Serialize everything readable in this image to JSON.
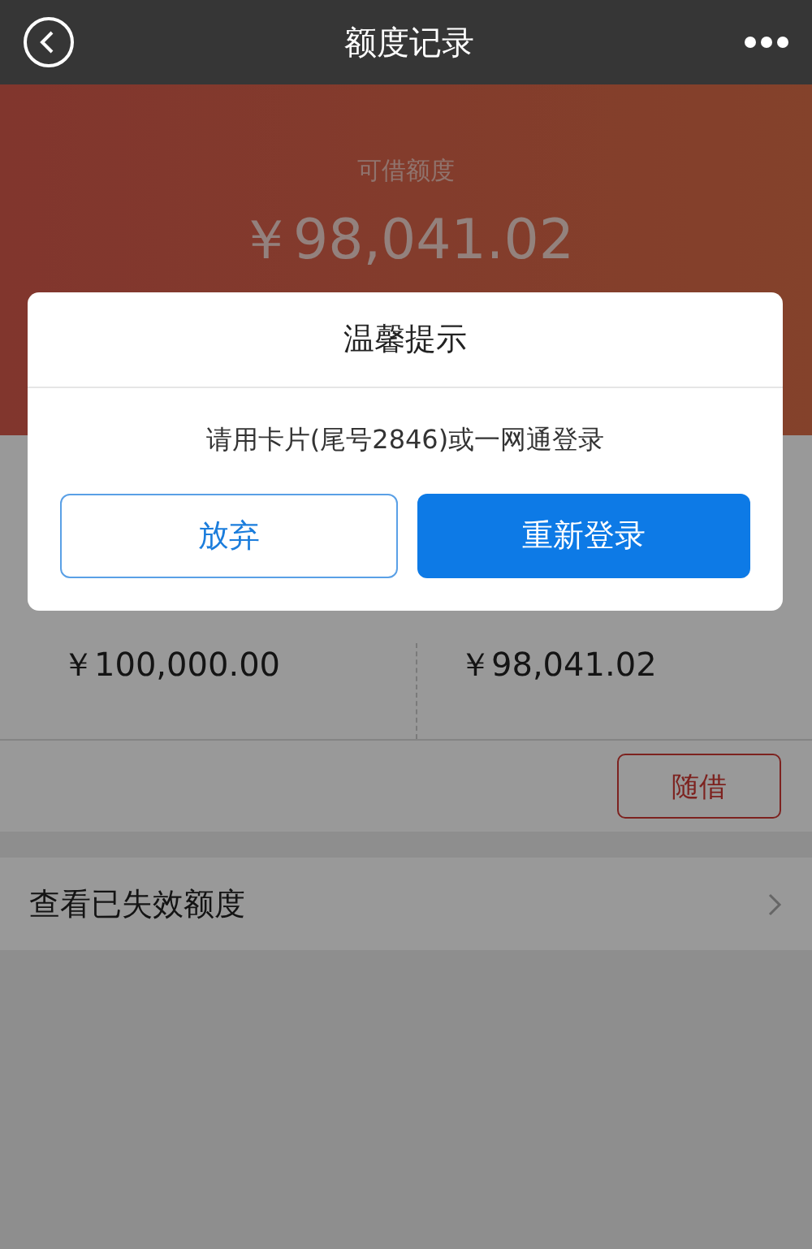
{
  "header": {
    "title": "额度记录"
  },
  "banner": {
    "label": "可借额度",
    "amount": "￥98,041.02"
  },
  "limits": [
    {
      "amount": "￥100,000.00"
    },
    {
      "amount": "￥98,041.02"
    }
  ],
  "borrow_button": "随借",
  "expired_link": "查看已失效额度",
  "dialog": {
    "title": "温馨提示",
    "message": "请用卡片(尾号2846)或一网通登录",
    "buttons": [
      {
        "label": "放弃",
        "kind": "secondary"
      },
      {
        "label": "重新登录",
        "kind": "primary"
      }
    ]
  }
}
